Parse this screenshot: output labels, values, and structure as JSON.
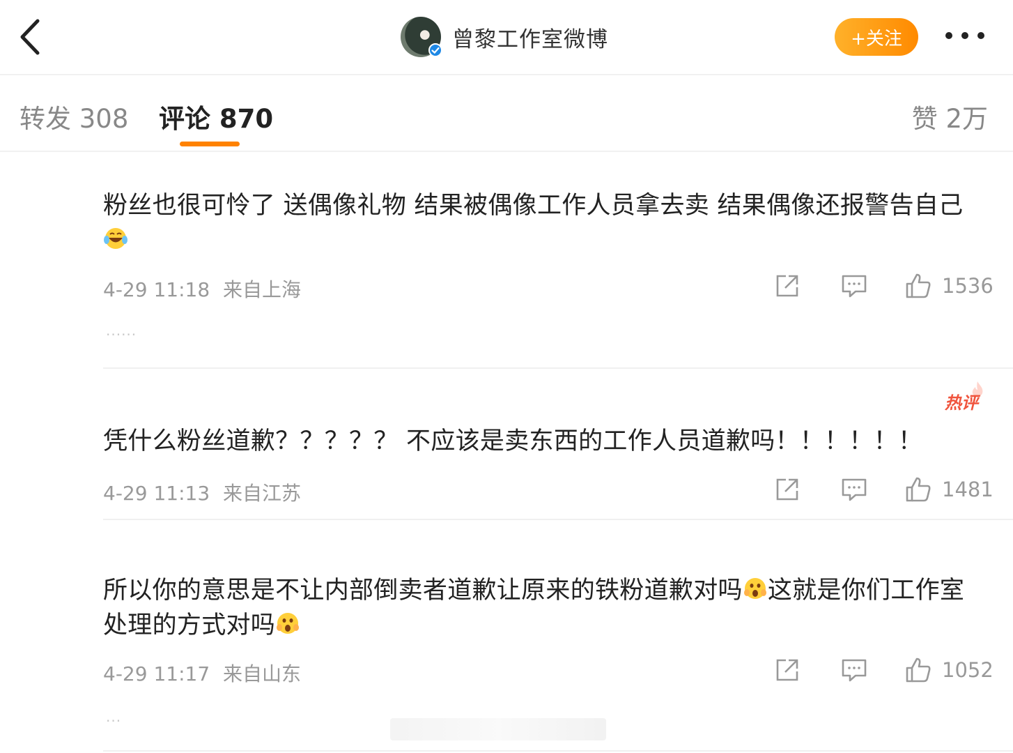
{
  "header": {
    "account_name": "曾黎工作室微博",
    "follow_label": "+关注",
    "back_icon": "chevron-left-icon",
    "more_icon": "more-dots-icon"
  },
  "tabs": {
    "repost": "转发 308",
    "comments": "评论 870",
    "likes": "赞 2万",
    "active": "comments",
    "accent": "#ff8200"
  },
  "comments": [
    {
      "text": "粉丝也很可怜了 送偶像礼物 结果被偶像工作人员拿去卖 结果偶像还报警告自己",
      "emoji": "laugh-cry-emoji",
      "time": "4-29 11:18",
      "location": "来自上海",
      "likes": "1536",
      "more": "......"
    },
    {
      "text": "凭什么粉丝道歉？？？？？ 不应该是卖东西的工作人员道歉吗！！！！！！",
      "badge": "热评",
      "time": "4-29 11:13",
      "location": "来自江苏",
      "likes": "1481"
    },
    {
      "text_part1": "所以你的意思是不让内部倒卖者道歉让原来的铁粉道歉对吗",
      "text_part2": "这就是你们工作室处理的方式对吗",
      "emoji": "scream-emoji",
      "time": "4-29 11:17",
      "location": "来自山东",
      "likes": "1052",
      "more": "..."
    }
  ],
  "colors": {
    "follow_gradient_start": "#ffb12a",
    "follow_gradient_end": "#ff8a00",
    "hot_badge": "#f0543d",
    "meta_text": "#999999"
  }
}
